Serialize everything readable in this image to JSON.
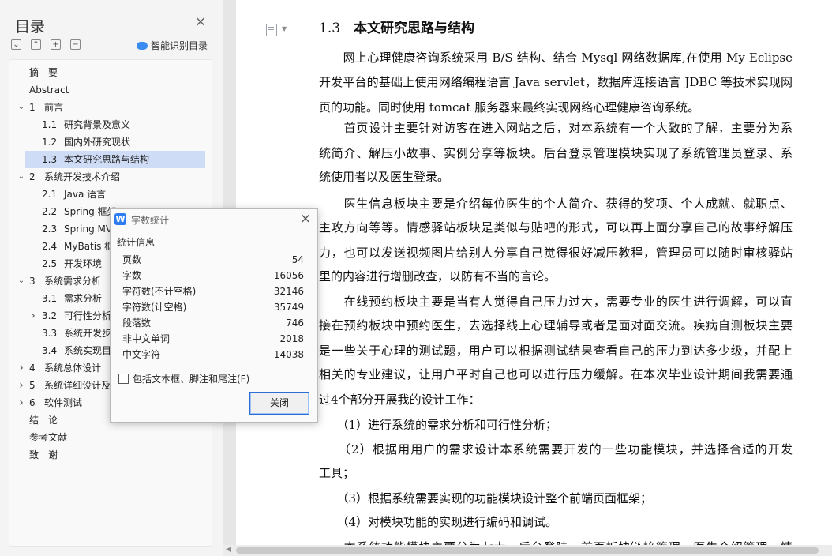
{
  "toc": {
    "title": "目录",
    "smart_label": "智能识别目录",
    "items": [
      {
        "num": "",
        "label": "摘　要",
        "level": 0,
        "chev": ""
      },
      {
        "num": "",
        "label": "Abstract",
        "level": 0,
        "chev": ""
      },
      {
        "num": "1",
        "label": "前言",
        "level": 0,
        "chev": "v"
      },
      {
        "num": "1.1",
        "label": "研究背景及意义",
        "level": 1,
        "chev": ""
      },
      {
        "num": "1.2",
        "label": "国内外研究现状",
        "level": 1,
        "chev": ""
      },
      {
        "num": "1.3",
        "label": "本文研究思路与结构",
        "level": 1,
        "chev": "",
        "active": true
      },
      {
        "num": "2",
        "label": "系统开发技术介绍",
        "level": 0,
        "chev": "v"
      },
      {
        "num": "2.1",
        "label": "Java 语言",
        "level": 1,
        "chev": ""
      },
      {
        "num": "2.2",
        "label": "Spring 框架",
        "level": 1,
        "chev": ""
      },
      {
        "num": "2.3",
        "label": "Spring MVC",
        "level": 1,
        "chev": ""
      },
      {
        "num": "2.4",
        "label": "MyBatis 框架",
        "level": 1,
        "chev": ""
      },
      {
        "num": "2.5",
        "label": "开发环境",
        "level": 1,
        "chev": ""
      },
      {
        "num": "3",
        "label": "系统需求分析",
        "level": 0,
        "chev": "v"
      },
      {
        "num": "3.1",
        "label": "需求分析",
        "level": 1,
        "chev": ""
      },
      {
        "num": "3.2",
        "label": "可行性分析",
        "level": 1,
        "chev": ">"
      },
      {
        "num": "3.3",
        "label": "系统开发步骤",
        "level": 1,
        "chev": ""
      },
      {
        "num": "3.4",
        "label": "系统实现目标",
        "level": 1,
        "chev": ""
      },
      {
        "num": "4",
        "label": "系统总体设计",
        "level": 0,
        "chev": ">"
      },
      {
        "num": "5",
        "label": "系统详细设计及实现",
        "level": 0,
        "chev": ">"
      },
      {
        "num": "6",
        "label": "软件测试",
        "level": 0,
        "chev": ">"
      },
      {
        "num": "",
        "label": "结　论",
        "level": 0,
        "chev": ""
      },
      {
        "num": "",
        "label": "参考文献",
        "level": 0,
        "chev": ""
      },
      {
        "num": "",
        "label": "致　谢",
        "level": 0,
        "chev": ""
      }
    ]
  },
  "document": {
    "heading_num": "1.3",
    "heading_text": "本文研究思路与结构",
    "lines": [
      {
        "text": "　　网上心理健康咨询系统采用 B/S 结构、结合 Mysql 网络数据库,在使用 My Eclipse",
        "justify": true
      },
      {
        "text": "开发平台的基础上使用网络编程语言 Java servlet，数据库连接语言 JDBC 等技术实现网",
        "justify": true
      },
      {
        "text": "页的功能。同时使用 tomcat 服务器来最终实现网络心理健康咨询系统。",
        "justify": false
      },
      {
        "text": "　　首页设计主要针对访客在进入网站之后，对本系统有一个大致的了解，主要分为系",
        "justify": true
      },
      {
        "text": "统简介、解压小故事、实例分享等板块。后台登录管理模块实现了系统管理员登录、系",
        "justify": true
      },
      {
        "text": "统使用者以及医生登录。",
        "justify": false
      },
      {
        "text": "　　医生信息板块主要是介绍每位医生的个人简介、获得的奖项、个人成就、就职点、",
        "justify": true
      },
      {
        "text": "主攻方向等等。情感驿站板块是类似与贴吧的形式，可以再上面分享自己的故事纾解压",
        "justify": true
      },
      {
        "text": "力，也可以发送视频图片给别人分享自己觉得很好减压教程，管理员可以随时审核驿站",
        "justify": true
      },
      {
        "text": "里的内容进行增删改查，以防有不当的言论。",
        "justify": false
      },
      {
        "text": "　　在线预约板块主要是当有人觉得自己压力过大，需要专业的医生进行调解，可以直",
        "justify": true
      },
      {
        "text": "接在预约板块中预约医生，去选择线上心理辅导或者是面对面交流。疾病自测板块主要",
        "justify": true
      },
      {
        "text": "是一些关于心理的测试题，用户可以根据测试结果查看自己的压力到达多少级，并配上",
        "justify": true
      },
      {
        "text": "相关的专业建议，让用户平时自己也可以进行压力缓解。在本次毕业设计期间我需要通",
        "justify": true
      },
      {
        "text": "过4个部分开展我的设计工作：",
        "justify": false
      },
      {
        "text": "　　（1）进行系统的需求分析和可行性分析；",
        "justify": false
      },
      {
        "text": "　　（2）根据用用户的需求设计本系统需要开发的一些功能模块，并选择合适的开发",
        "justify": true
      },
      {
        "text": "工具；",
        "justify": false
      },
      {
        "text": "　　（3）根据系统需要实现的功能模块设计整个前端页面框架；",
        "justify": false
      },
      {
        "text": "　　（4）对模块功能的实现进行编码和调试。",
        "justify": false
      },
      {
        "text": "　　本系统功能模块主要分为七大，后台登陆，首页板块链接管理，医生介绍管理，情",
        "justify": true
      }
    ]
  },
  "dialog": {
    "logo": "W",
    "title": "字数统计",
    "section": "统计信息",
    "rows": [
      {
        "label": "页数",
        "value": "54"
      },
      {
        "label": "字数",
        "value": "16056"
      },
      {
        "label": "字符数(不计空格)",
        "value": "32146"
      },
      {
        "label": "字符数(计空格)",
        "value": "35749"
      },
      {
        "label": "段落数",
        "value": "746"
      },
      {
        "label": "非中文单词",
        "value": "2018"
      },
      {
        "label": "中文字符",
        "value": "14038"
      }
    ],
    "checkbox_label": "包括文本框、脚注和尾注(F)",
    "close_button": "关闭"
  }
}
